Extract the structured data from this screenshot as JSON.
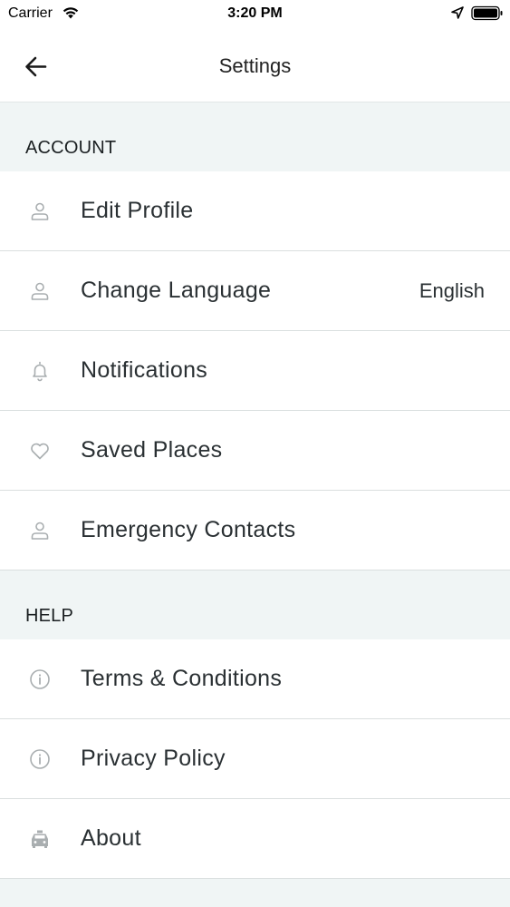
{
  "status_bar": {
    "carrier": "Carrier",
    "time": "3:20 PM"
  },
  "nav": {
    "title": "Settings",
    "back_icon": "arrow-left-icon"
  },
  "sections": [
    {
      "header": "ACCOUNT",
      "items": [
        {
          "label": "Edit Profile",
          "icon": "person-icon",
          "value": ""
        },
        {
          "label": "Change Language",
          "icon": "person-icon",
          "value": "English"
        },
        {
          "label": "Notifications",
          "icon": "bell-icon",
          "value": ""
        },
        {
          "label": "Saved Places",
          "icon": "heart-icon",
          "value": ""
        },
        {
          "label": "Emergency Contacts",
          "icon": "person-icon",
          "value": ""
        }
      ]
    },
    {
      "header": "HELP",
      "items": [
        {
          "label": "Terms & Conditions",
          "icon": "info-icon",
          "value": ""
        },
        {
          "label": "Privacy Policy",
          "icon": "info-icon",
          "value": ""
        },
        {
          "label": "About",
          "icon": "taxi-icon",
          "value": ""
        }
      ]
    }
  ],
  "colors": {
    "section_background": "#f0f5f5",
    "icon_gray": "#a9aeb0",
    "divider": "#dadfdf"
  }
}
